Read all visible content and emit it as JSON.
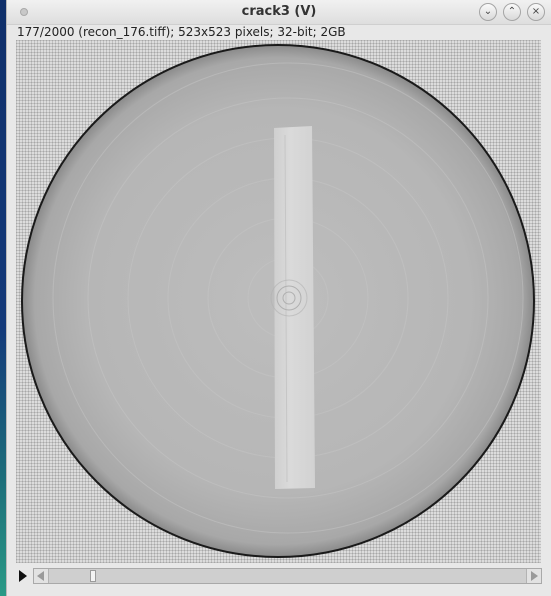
{
  "window": {
    "title": "crack3 (V)",
    "info": "177/2000 (recon_176.tiff); 523x523 pixels; 32-bit; 2GB",
    "buttons": {
      "minimize_glyph": "⌄",
      "maximize_glyph": "⌃",
      "close_glyph": "×"
    }
  },
  "stack": {
    "current_slice": 177,
    "total_slices": 2000
  },
  "icons": {
    "play": "play-icon",
    "scroll_left": "arrow-left-icon",
    "scroll_right": "arrow-right-icon"
  }
}
